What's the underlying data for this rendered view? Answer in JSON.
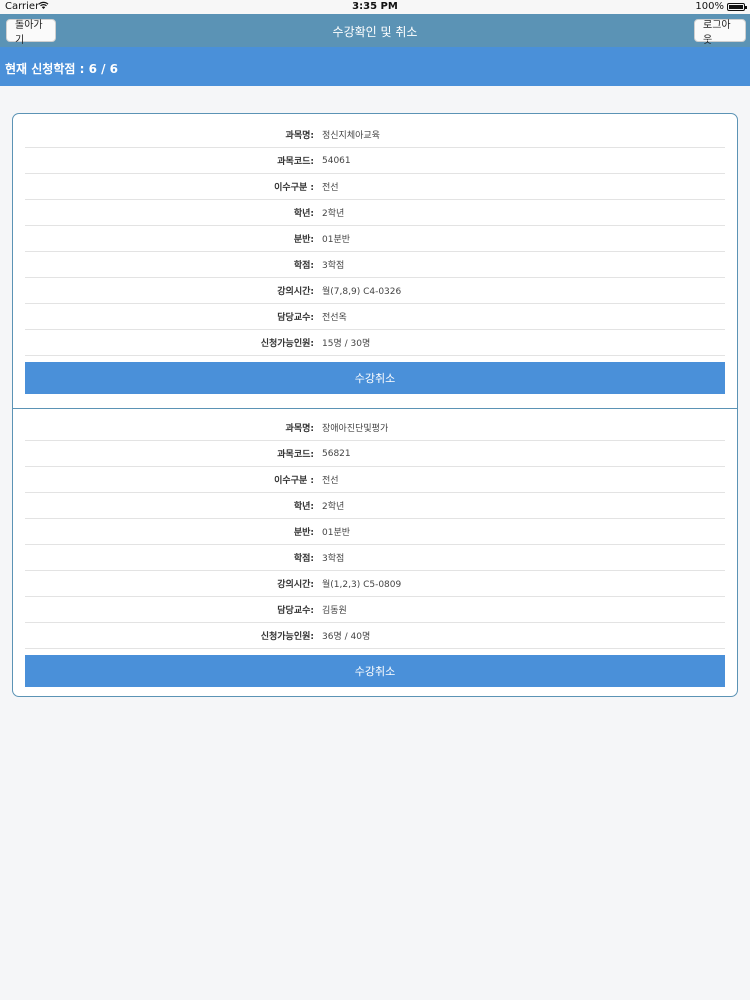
{
  "status_bar": {
    "carrier": "Carrier",
    "wifi_icon": "wifi-icon",
    "time": "3:35 PM",
    "battery_text": "100%",
    "battery_level": 1.0
  },
  "navbar": {
    "title": "수강확인 및 취소",
    "back_label": "돌아가기",
    "logout_label": "로그아웃",
    "color": "#5b93b5"
  },
  "credits": {
    "text": "현재 신청학점 : 6 / 6",
    "color": "#4a90d9"
  },
  "field_labels": {
    "name": "과목명:",
    "code": "과목코드:",
    "category": "이수구분 :",
    "grade": "학년:",
    "section": "분반:",
    "credits": "학점:",
    "time": "강의시간:",
    "professor": "담당교수:",
    "capacity": "신청가능인원:"
  },
  "courses": [
    {
      "name": "정신지체아교육",
      "code": "54061",
      "category": "전선",
      "grade": "2학년",
      "section": "01분반",
      "credits": "3학점",
      "time": "월(7,8,9) C4-0326",
      "professor": "전선옥",
      "capacity": "15명 / 30명",
      "cancel_label": "수강취소"
    },
    {
      "name": "장애아진단및평가",
      "code": "56821",
      "category": "전선",
      "grade": "2학년",
      "section": "01분반",
      "credits": "3학점",
      "time": "월(1,2,3) C5-0809",
      "professor": "김동원",
      "capacity": "36명 / 40명",
      "cancel_label": "수강취소"
    }
  ]
}
